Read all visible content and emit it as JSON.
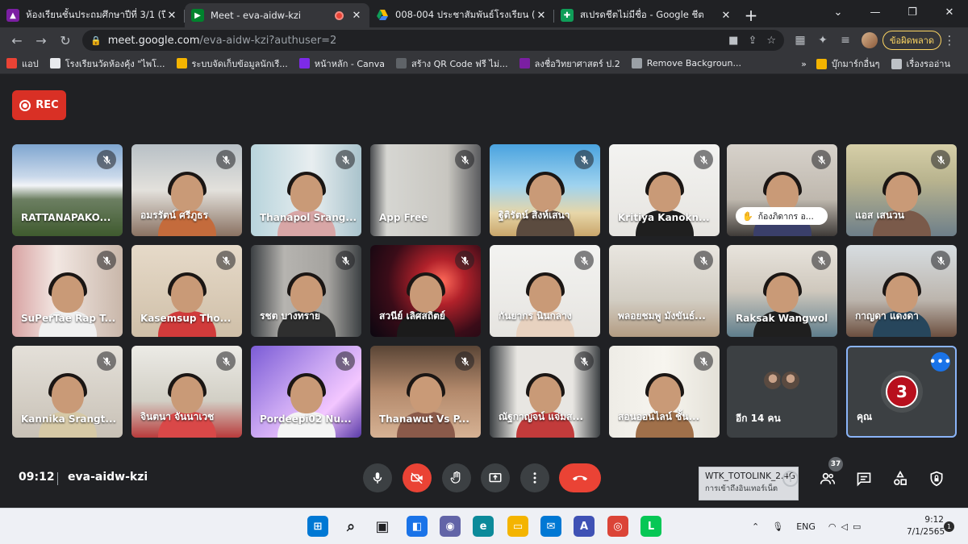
{
  "browser": {
    "tabs": [
      {
        "title": "ห้องเรียนชั้นประถมศึกษาปีที่ 3/1 (ปีการ",
        "close": "✕",
        "color": "#7b1fa2"
      },
      {
        "title": "Meet - eva-aidw-kzi",
        "close": "✕",
        "color": "#00832d"
      },
      {
        "title": "008-004 ประชาสัมพันธ์โรงเรียน (ภัคดี",
        "close": "✕",
        "color": "#1a73e8"
      },
      {
        "title": "สเปรดชีตไม่มีชื่อ - Google ชีต",
        "close": "✕",
        "color": "#0f9d58"
      }
    ],
    "new_tab": "+",
    "window_controls": {
      "chevron": "⌄",
      "minimize": "—",
      "restore": "❐",
      "close": "✕"
    },
    "address": {
      "host": "meet.google.com",
      "path": "/eva-aidw-kzi?authuser=2"
    },
    "error_button": "ข้อผิดพลาด",
    "bookmarks": [
      {
        "label": "แอป",
        "color": "#ea4335"
      },
      {
        "label": "โรงเรียนวัดห้องคุ้ง \"ไพโ...",
        "color": "#e8eaed"
      },
      {
        "label": "ระบบจัดเก็บข้อมูลนักเรี...",
        "color": "#f4b400"
      },
      {
        "label": "หน้าหลัก - Canva",
        "color": "#7d2ae8"
      },
      {
        "label": "สร้าง QR Code ฟรี ไม่...",
        "color": "#5f6368"
      },
      {
        "label": "ลงชื่อวิทยาศาสตร์ ป.2",
        "color": "#7b1fa2"
      },
      {
        "label": "Remove Backgroun...",
        "color": "#9aa0a6"
      }
    ],
    "bookmarks_more": "»",
    "bookmarks_right": [
      {
        "label": "บุ๊กมาร์กอื่นๆ",
        "color": "#f4b400"
      },
      {
        "label": "เรื่องรออ่าน",
        "color": "#bdc1c6"
      }
    ]
  },
  "meet": {
    "rec_label": "REC",
    "tiles": [
      {
        "name": "RATTANAPAKO...",
        "bg": "mountain"
      },
      {
        "name": "อมรรัตน์ ศรีภูธร",
        "bg": "room1"
      },
      {
        "name": "Thanapol Srang...",
        "bg": "room2"
      },
      {
        "name": "App Free",
        "bg": "wall"
      },
      {
        "name": "ฐิติรัตน์ สิงห์เสนา",
        "bg": "beach"
      },
      {
        "name": "Kritiya Kanokn...",
        "bg": "white"
      },
      {
        "name": "",
        "hand": "ก้องภิดากร อ...",
        "bg": "room3"
      },
      {
        "name": "แอส เสนวน",
        "bg": "class"
      },
      {
        "name": "SuPerTae Rap T...",
        "bg": "room4"
      },
      {
        "name": "Kasemsup Tho...",
        "bg": "beige"
      },
      {
        "name": "รชต บางทราย",
        "bg": "grey"
      },
      {
        "name": "สวนีย์ เลิศสถิตย์",
        "bg": "space"
      },
      {
        "name": "กันยากร นินกลาง",
        "bg": "white"
      },
      {
        "name": "พลอยชมพู มังขันธ์...",
        "bg": "room5"
      },
      {
        "name": "Raksak Wangwol",
        "bg": "ceiling"
      },
      {
        "name": "กาญดา แดงดา",
        "bg": "room6"
      },
      {
        "name": "Kannika Srangt...",
        "bg": "room7"
      },
      {
        "name": "จินตนา จันนาเวช",
        "bg": "room8"
      },
      {
        "name": "Pordeepi02 Nu...",
        "bg": "purple"
      },
      {
        "name": "Thanawut Vs P...",
        "bg": "closeup"
      },
      {
        "name": "ณัฐกาญจน์ แจ่มส...",
        "bg": "pattern"
      },
      {
        "name": "สอนออนไลน์ ชั้น...",
        "bg": "board"
      }
    ],
    "others_label": "อีก 14 คน",
    "self": {
      "initial": "3",
      "label": "คุณ",
      "more": "•••"
    },
    "bar": {
      "time": "09:12",
      "code": "eva-aidw-kzi",
      "people_count": "37"
    },
    "network_popup": {
      "ssid": "WTK_TOTOLINK_2.4G",
      "status": "การเข้าถึงอินเทอร์เน็ต",
      "info": "i"
    }
  },
  "taskbar": {
    "lang": "ENG",
    "time": "9:12",
    "date": "7/1/2565",
    "notifications": "1",
    "apps": [
      {
        "name": "start",
        "color": "#0078d4"
      },
      {
        "name": "search",
        "color": "#202124"
      },
      {
        "name": "taskview",
        "color": "#202124"
      },
      {
        "name": "widgets",
        "color": "#1a73e8"
      },
      {
        "name": "chat",
        "color": "#6264a7"
      },
      {
        "name": "edge",
        "color": "#0c8a9a"
      },
      {
        "name": "explorer",
        "color": "#f4b400"
      },
      {
        "name": "mail",
        "color": "#0078d4"
      },
      {
        "name": "app",
        "color": "#3f51b5"
      },
      {
        "name": "chrome",
        "color": "#db4437"
      },
      {
        "name": "line",
        "color": "#06c755"
      }
    ]
  }
}
